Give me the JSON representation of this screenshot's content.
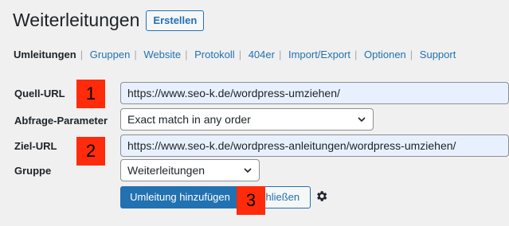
{
  "header": {
    "title": "Weiterleitungen",
    "create_label": "Erstellen"
  },
  "subnav": [
    {
      "label": "Umleitungen",
      "current": true
    },
    {
      "label": "Gruppen"
    },
    {
      "label": "Website"
    },
    {
      "label": "Protokoll"
    },
    {
      "label": "404er"
    },
    {
      "label": "Import/Export"
    },
    {
      "label": "Optionen"
    },
    {
      "label": "Support"
    }
  ],
  "form": {
    "source_label": "Quell-URL",
    "source_value": "https://www.seo-k.de/wordpress-umziehen/",
    "query_label": "Abfrage-Parameter",
    "query_value": "Exact match in any order",
    "target_label": "Ziel-URL",
    "target_value": "https://www.seo-k.de/wordpress-anleitungen/wordpress-umziehen/",
    "group_label": "Gruppe",
    "group_value": "Weiterleitungen",
    "add_label": "Umleitung hinzufügen",
    "close_label": "chließen"
  },
  "badges": {
    "b1": "1",
    "b2": "2",
    "b3": "3"
  },
  "colors": {
    "accent": "#2271b1",
    "badge": "#ff2b0a",
    "field_fill": "#e8f0fe"
  },
  "icons": {
    "settings": "gear-icon",
    "dropdown": "chevron-down-icon"
  }
}
